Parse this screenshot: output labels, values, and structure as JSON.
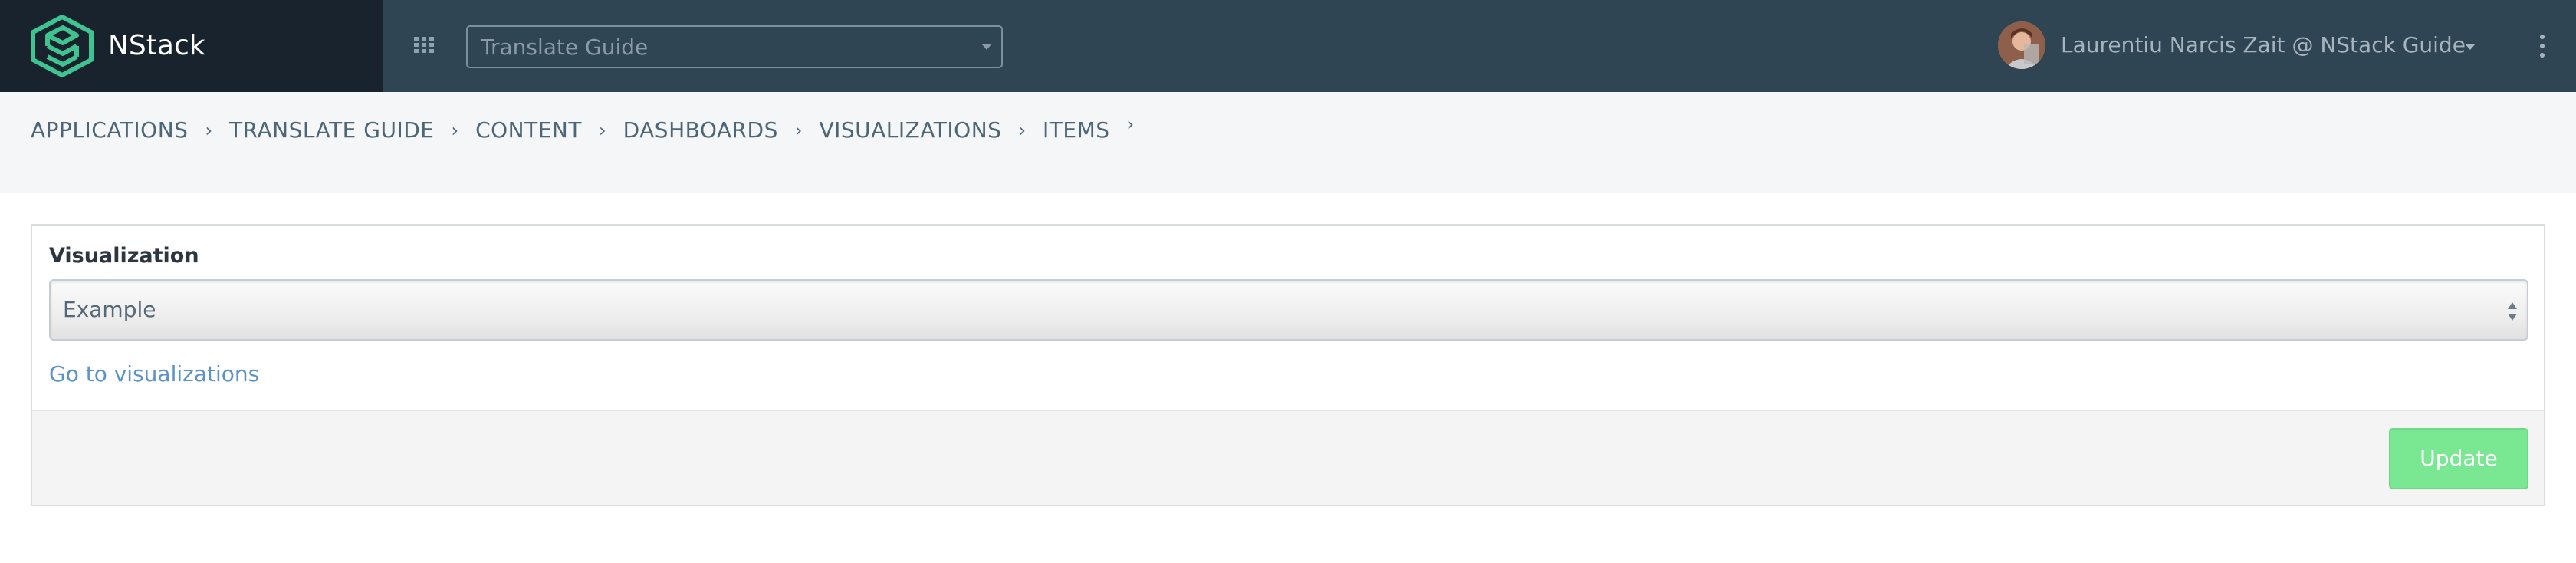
{
  "brand": {
    "name": "NStack",
    "logo_icon": "nstack-logo-icon",
    "accent": "#3ec391"
  },
  "topbar": {
    "apps_icon": "grid-icon",
    "app_selector": {
      "value": "Translate Guide"
    },
    "user": {
      "name": "Laurentiu Narcis Zait @ NStack Guide"
    },
    "menu_icon": "kebab-icon",
    "background": "#2f4554"
  },
  "breadcrumb": [
    {
      "label": "APPLICATIONS"
    },
    {
      "label": "TRANSLATE GUIDE"
    },
    {
      "label": "CONTENT"
    },
    {
      "label": "DASHBOARDS"
    },
    {
      "label": "VISUALIZATIONS"
    },
    {
      "label": "ITEMS"
    }
  ],
  "form": {
    "field_label": "Visualization",
    "select_value": "Example",
    "link_label": "Go to visualizations",
    "submit_label": "Update",
    "submit_color": "#7ae793"
  }
}
